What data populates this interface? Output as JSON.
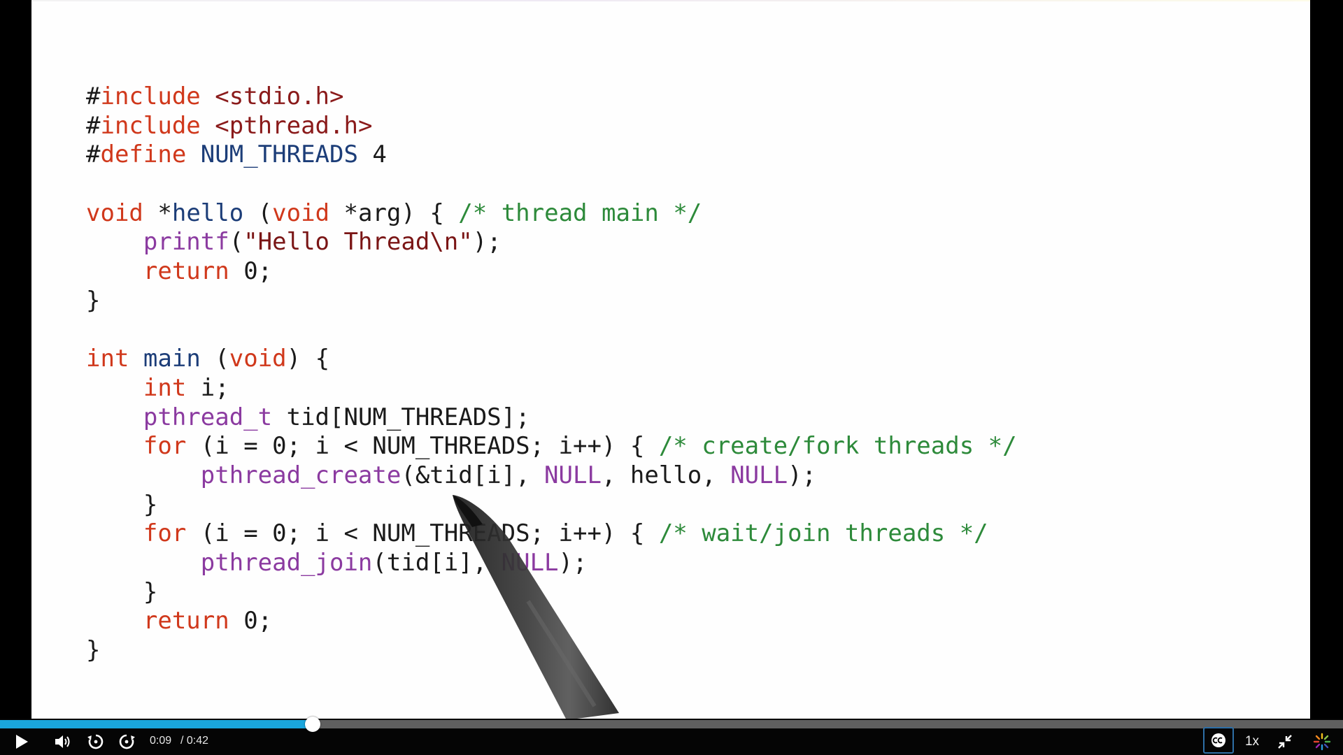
{
  "code": {
    "lines": [
      [
        {
          "t": "#",
          "c": "plain"
        },
        {
          "t": "include",
          "c": "kw"
        },
        {
          "t": " <stdio.h>",
          "c": "inc"
        }
      ],
      [
        {
          "t": "#",
          "c": "plain"
        },
        {
          "t": "include",
          "c": "kw"
        },
        {
          "t": " <pthread.h>",
          "c": "inc"
        }
      ],
      [
        {
          "t": "#",
          "c": "plain"
        },
        {
          "t": "define",
          "c": "kw"
        },
        {
          "t": " NUM_THREADS",
          "c": "macro"
        },
        {
          "t": " 4",
          "c": "plain"
        }
      ],
      [],
      [
        {
          "t": "void",
          "c": "kw"
        },
        {
          "t": " *",
          "c": "plain"
        },
        {
          "t": "hello",
          "c": "macro"
        },
        {
          "t": " (",
          "c": "plain"
        },
        {
          "t": "void",
          "c": "kw"
        },
        {
          "t": " *arg) { ",
          "c": "plain"
        },
        {
          "t": "/* thread main */",
          "c": "cmt"
        }
      ],
      [
        {
          "t": "    ",
          "c": "plain"
        },
        {
          "t": "printf",
          "c": "func"
        },
        {
          "t": "(",
          "c": "plain"
        },
        {
          "t": "\"Hello Thread\\n\"",
          "c": "str"
        },
        {
          "t": ");",
          "c": "plain"
        }
      ],
      [
        {
          "t": "    ",
          "c": "plain"
        },
        {
          "t": "return",
          "c": "kw"
        },
        {
          "t": " 0;",
          "c": "plain"
        }
      ],
      [
        {
          "t": "}",
          "c": "plain"
        }
      ],
      [],
      [
        {
          "t": "int",
          "c": "kw"
        },
        {
          "t": " ",
          "c": "plain"
        },
        {
          "t": "main",
          "c": "macro"
        },
        {
          "t": " (",
          "c": "plain"
        },
        {
          "t": "void",
          "c": "kw"
        },
        {
          "t": ") {",
          "c": "plain"
        }
      ],
      [
        {
          "t": "    ",
          "c": "plain"
        },
        {
          "t": "int",
          "c": "kw"
        },
        {
          "t": " i;",
          "c": "plain"
        }
      ],
      [
        {
          "t": "    ",
          "c": "plain"
        },
        {
          "t": "pthread_t",
          "c": "func"
        },
        {
          "t": " tid[NUM_THREADS];",
          "c": "plain"
        }
      ],
      [
        {
          "t": "    ",
          "c": "plain"
        },
        {
          "t": "for",
          "c": "kw"
        },
        {
          "t": " (i = 0; i < NUM_THREADS; i++) { ",
          "c": "plain"
        },
        {
          "t": "/* create/fork threads */",
          "c": "cmt"
        }
      ],
      [
        {
          "t": "        ",
          "c": "plain"
        },
        {
          "t": "pthread_create",
          "c": "func"
        },
        {
          "t": "(&tid[i], ",
          "c": "plain"
        },
        {
          "t": "NULL",
          "c": "func"
        },
        {
          "t": ", hello, ",
          "c": "plain"
        },
        {
          "t": "NULL",
          "c": "func"
        },
        {
          "t": ");",
          "c": "plain"
        }
      ],
      [
        {
          "t": "    }",
          "c": "plain"
        }
      ],
      [
        {
          "t": "    ",
          "c": "plain"
        },
        {
          "t": "for",
          "c": "kw"
        },
        {
          "t": " (i = 0; i < NUM_THREADS; i++) { ",
          "c": "plain"
        },
        {
          "t": "/* wait/join threads */",
          "c": "cmt"
        }
      ],
      [
        {
          "t": "        ",
          "c": "plain"
        },
        {
          "t": "pthread_join",
          "c": "func"
        },
        {
          "t": "(tid[i], ",
          "c": "plain"
        },
        {
          "t": "NULL",
          "c": "func"
        },
        {
          "t": ");",
          "c": "plain"
        }
      ],
      [
        {
          "t": "    }",
          "c": "plain"
        }
      ],
      [
        {
          "t": "    ",
          "c": "plain"
        },
        {
          "t": "return",
          "c": "kw"
        },
        {
          "t": " 0;",
          "c": "plain"
        }
      ],
      [
        {
          "t": "}",
          "c": "plain"
        }
      ]
    ]
  },
  "player": {
    "current_time": "0:09",
    "duration": "/ 0:42",
    "progress_fraction": 0.233,
    "speed_label": "1x",
    "colors": {
      "progress_fill": "#1aa6dd",
      "track": "#5f5f5f",
      "cc_border": "#2e6fa6"
    },
    "icons": {
      "play": "play-icon",
      "volume": "volume-icon",
      "rewind": "rewind-icon",
      "forward": "forward-icon",
      "captions": "closed-captions-icon",
      "exit_fullscreen": "exit-fullscreen-icon",
      "loader": "loading-spinner-icon"
    }
  }
}
